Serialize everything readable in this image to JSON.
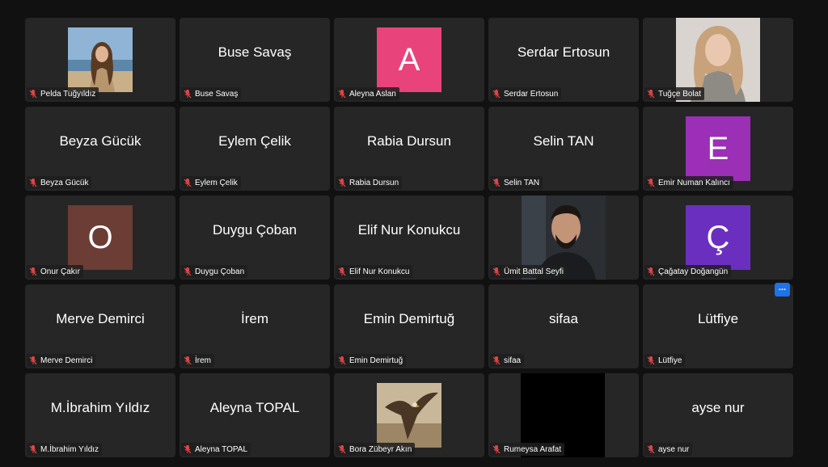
{
  "colors": {
    "background": "#111111",
    "tile": "#262626",
    "avatar_a": "#e8437a",
    "avatar_e": "#9b2fb6",
    "avatar_o": "#6b3d34",
    "avatar_c": "#6b2fc0",
    "muted_mic": "#e04545",
    "more_button": "#1f72e8"
  },
  "icons": {
    "muted": "muted-mic-icon",
    "more": "more-options-icon"
  },
  "more_label": "...",
  "participants": [
    {
      "name": "Pelda Tuğyıldız",
      "tile_text": "",
      "avatar": "",
      "has_photo": true
    },
    {
      "name": "Buse Savaş",
      "tile_text": "Buse Savaş",
      "avatar": ""
    },
    {
      "name": "Aleyna Aslan",
      "tile_text": "",
      "avatar": "A"
    },
    {
      "name": "Serdar Ertosun",
      "tile_text": "Serdar Ertosun",
      "avatar": ""
    },
    {
      "name": "Tuğçe Bolat",
      "tile_text": "",
      "avatar": "",
      "has_photo": true
    },
    {
      "name": "Beyza Gücük",
      "tile_text": "Beyza Gücük",
      "avatar": ""
    },
    {
      "name": "Eylem Çelik",
      "tile_text": "Eylem Çelik",
      "avatar": ""
    },
    {
      "name": "Rabia Dursun",
      "tile_text": "Rabia Dursun",
      "avatar": ""
    },
    {
      "name": "Selin TAN",
      "tile_text": "Selin TAN",
      "avatar": ""
    },
    {
      "name": "Emir Numan Kalıncı",
      "tile_text": "",
      "avatar": "E"
    },
    {
      "name": "Onur Çakır",
      "tile_text": "",
      "avatar": "O"
    },
    {
      "name": "Duygu Çoban",
      "tile_text": "Duygu Çoban",
      "avatar": ""
    },
    {
      "name": "Elif Nur Konukcu",
      "tile_text": "Elif Nur Konukcu",
      "avatar": ""
    },
    {
      "name": "Ümit Battal Seyfi",
      "tile_text": "",
      "avatar": "",
      "has_photo": true
    },
    {
      "name": "Çağatay Doğangün",
      "tile_text": "",
      "avatar": "Ç"
    },
    {
      "name": "Merve Demirci",
      "tile_text": "Merve Demirci",
      "avatar": ""
    },
    {
      "name": "İrem",
      "tile_text": "İrem",
      "avatar": ""
    },
    {
      "name": "Emin Demirtuğ",
      "tile_text": "Emin Demirtuğ",
      "avatar": ""
    },
    {
      "name": "sifaa",
      "tile_text": "sifaa",
      "avatar": ""
    },
    {
      "name": "Lütfiye",
      "tile_text": "Lütfiye",
      "avatar": ""
    },
    {
      "name": "M.İbrahim Yıldız",
      "tile_text": "M.İbrahim Yıldız",
      "avatar": ""
    },
    {
      "name": "Aleyna TOPAL",
      "tile_text": "Aleyna TOPAL",
      "avatar": ""
    },
    {
      "name": "Bora Zübeyr Akın",
      "tile_text": "",
      "avatar": "",
      "has_photo": true
    },
    {
      "name": "Rumeysa Arafat",
      "tile_text": "",
      "avatar": "",
      "has_video": true
    },
    {
      "name": "ayse nur",
      "tile_text": "ayse nur",
      "avatar": ""
    }
  ]
}
